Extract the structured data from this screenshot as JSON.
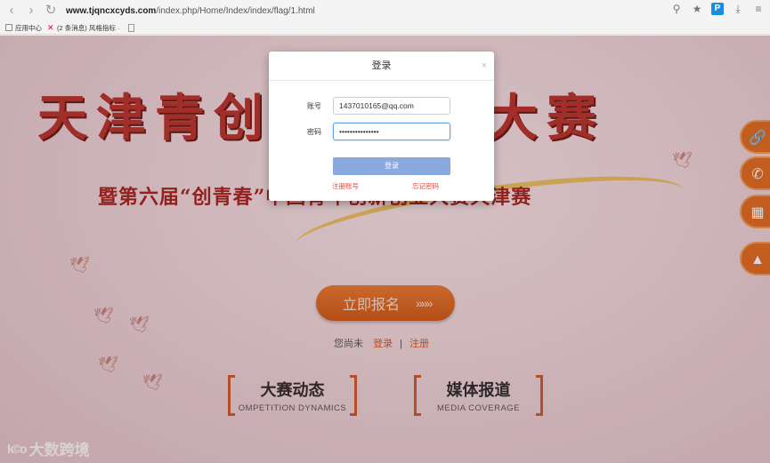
{
  "browser": {
    "url_host": "www.tjqncxcyds.com",
    "url_path": "/index.php/Home/Index/index/flag/1.html",
    "nav": {
      "back": "‹",
      "forward": "›",
      "reload": "↻"
    },
    "right_icons": {
      "tools": "⚲",
      "star": "★",
      "p": "P",
      "download": "⤓",
      "menu": "≡"
    }
  },
  "bookmarks": [
    {
      "label": "应用中心"
    },
    {
      "label": "(2 条消息) 风格指标 ·"
    }
  ],
  "banner": {
    "title": "天津青创业大赛",
    "title_left": "天津青创",
    "title_right": "创业大赛",
    "subtitle": "暨第六届“创青春”中国青年创新创业大赛天津赛"
  },
  "side_buttons": {
    "link": "🔗",
    "phone": "✆",
    "qr": "▦",
    "top": "▲"
  },
  "cta": {
    "label": "立即报名",
    "arrows": "»»»"
  },
  "login_line": {
    "prefix": "您尚未",
    "login": "登录",
    "sep": "|",
    "register": "注册"
  },
  "sections": [
    {
      "zh": "大赛动态",
      "en": "OMPETITION  DYNAMICS"
    },
    {
      "zh": "媒体报道",
      "en": "MEDIA COVERAGE"
    }
  ],
  "watermark": {
    "logo": "k©o",
    "text": "大数跨境"
  },
  "modal": {
    "title": "登录",
    "close": "×",
    "account_label": "账号",
    "account_value": "1437010165@qq.com",
    "password_label": "密码",
    "password_value": "•••••••••••••••",
    "submit": "登录",
    "register_link": "注册账号",
    "forgot_link": "忘记密码"
  }
}
